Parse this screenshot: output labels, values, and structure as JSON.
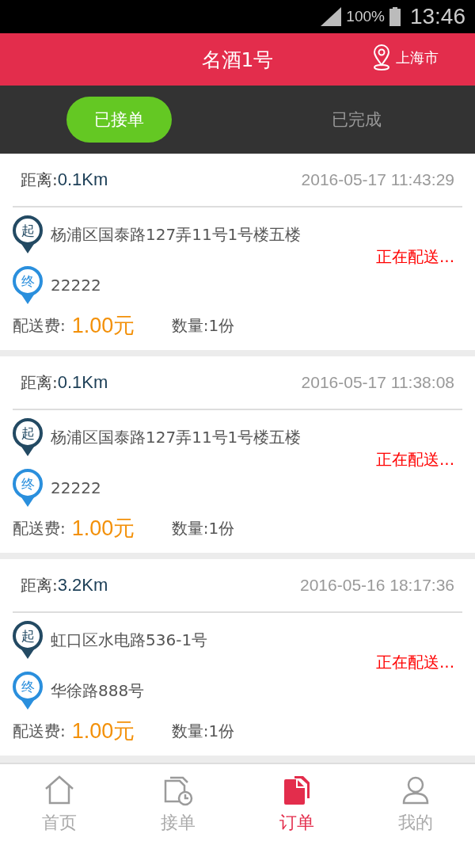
{
  "status_bar": {
    "battery": "100%",
    "time": "13:46"
  },
  "header": {
    "title": "名酒1号",
    "city": "上海市"
  },
  "tabs": [
    {
      "label": "已接单",
      "selected": true
    },
    {
      "label": "已完成",
      "selected": false
    }
  ],
  "orders": [
    {
      "distance_label": "距离:",
      "distance": "0.1Km",
      "time": "2016-05-17 11:43:29",
      "start_mark": "起",
      "start": "杨浦区国泰路127弄11号1号楼五楼",
      "end_mark": "终",
      "end": "22222",
      "status": "正在配送...",
      "fee_label": "配送费:",
      "fee": "1.00元",
      "quantity": "数量:1份"
    },
    {
      "distance_label": "距离:",
      "distance": "0.1Km",
      "time": "2016-05-17 11:38:08",
      "start_mark": "起",
      "start": "杨浦区国泰路127弄11号1号楼五楼",
      "end_mark": "终",
      "end": "22222",
      "status": "正在配送...",
      "fee_label": "配送费:",
      "fee": "1.00元",
      "quantity": "数量:1份"
    },
    {
      "distance_label": "距离:",
      "distance": "3.2Km",
      "time": "2016-05-16 18:17:36",
      "start_mark": "起",
      "start": "虹口区水电路536-1号",
      "end_mark": "终",
      "end": "华徐路888号",
      "status": "正在配送...",
      "fee_label": "配送费:",
      "fee": "1.00元",
      "quantity": "数量:1份"
    }
  ],
  "nav": [
    {
      "kind": "home",
      "label": "首页",
      "selected": false
    },
    {
      "kind": "accept",
      "label": "接单",
      "selected": false
    },
    {
      "kind": "orders",
      "label": "订单",
      "selected": true
    },
    {
      "kind": "me",
      "label": "我的",
      "selected": false
    }
  ]
}
